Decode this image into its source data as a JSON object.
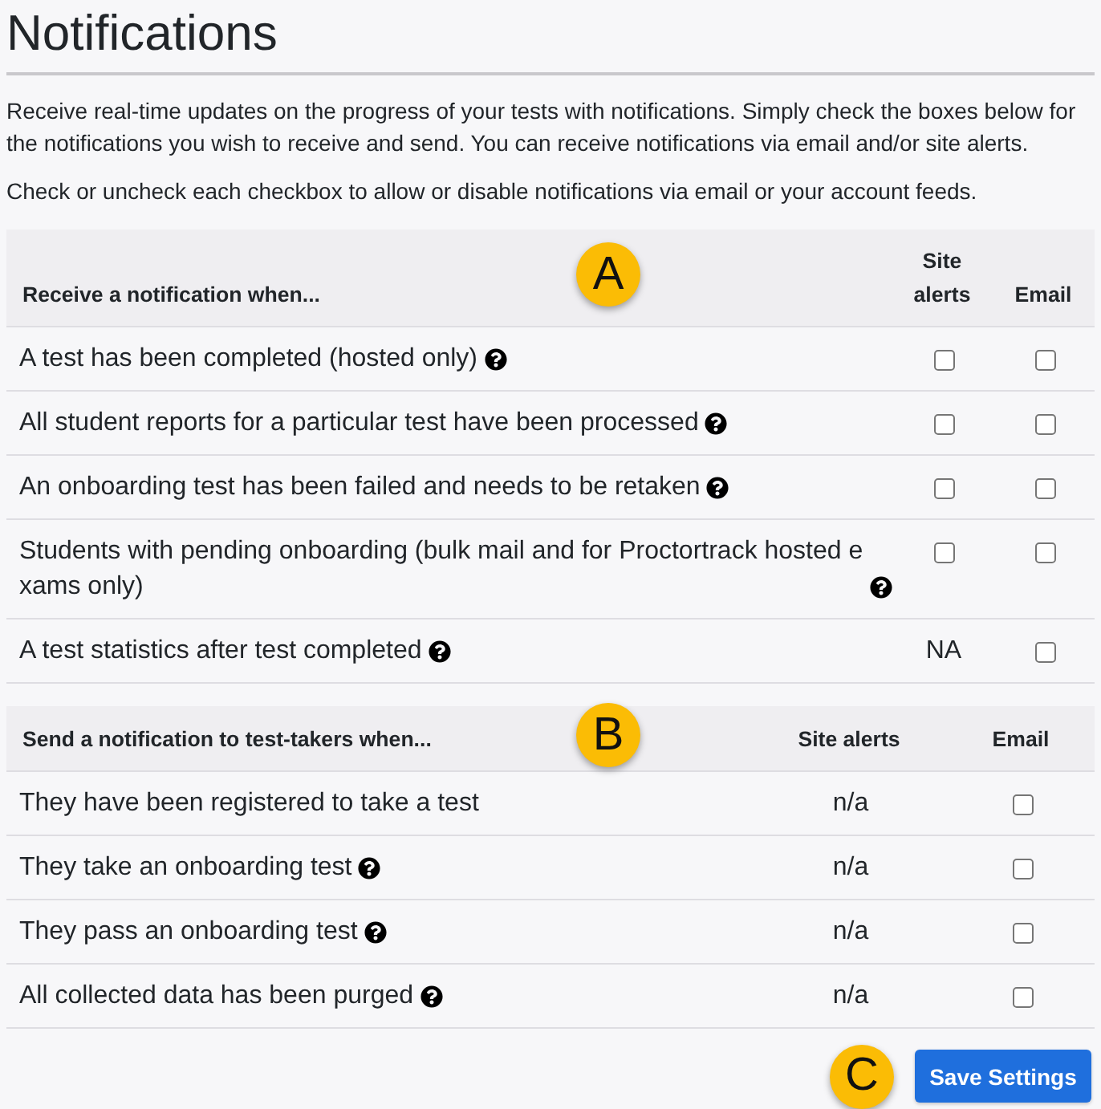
{
  "page": {
    "title": "Notifications",
    "intro": [
      "Receive real-time updates on the progress of your tests with notifications. Simply check the boxes below for the notifications you wish to receive and send. You can receive notifications via email and/or site alerts.",
      "Check or uncheck each checkbox to allow or disable notifications via email or your account feeds."
    ]
  },
  "receive_table": {
    "callout": "A",
    "columns": [
      "Receive a notification when...",
      "Site alerts",
      "Email"
    ],
    "rows": [
      {
        "label": "A test has been completed (hosted only)",
        "help": true,
        "site_alerts": {
          "kind": "checkbox",
          "checked": false
        },
        "email": {
          "kind": "checkbox",
          "checked": false
        }
      },
      {
        "label": "All student reports for a particular test have been processed",
        "help": true,
        "site_alerts": {
          "kind": "checkbox",
          "checked": false
        },
        "email": {
          "kind": "checkbox",
          "checked": false
        }
      },
      {
        "label": "An onboarding test has been failed and needs to be retaken",
        "help": true,
        "site_alerts": {
          "kind": "checkbox",
          "checked": false
        },
        "email": {
          "kind": "checkbox",
          "checked": false
        }
      },
      {
        "label": "Students with pending onboarding (bulk mail and for Proctortrack hosted exams only)",
        "help": true,
        "site_alerts": {
          "kind": "checkbox",
          "checked": false
        },
        "email": {
          "kind": "checkbox",
          "checked": false
        }
      },
      {
        "label": "A test statistics after test completed",
        "help": true,
        "site_alerts": {
          "kind": "text",
          "text": "NA"
        },
        "email": {
          "kind": "checkbox",
          "checked": false
        }
      }
    ]
  },
  "send_table": {
    "callout": "B",
    "columns": [
      "Send a notification to test-takers when...",
      "Site alerts",
      "Email"
    ],
    "rows": [
      {
        "label": "They have been registered to take a test",
        "help": false,
        "site_alerts": {
          "kind": "text",
          "text": "n/a"
        },
        "email": {
          "kind": "checkbox",
          "checked": false
        }
      },
      {
        "label": "They take an onboarding test",
        "help": true,
        "site_alerts": {
          "kind": "text",
          "text": "n/a"
        },
        "email": {
          "kind": "checkbox",
          "checked": false
        }
      },
      {
        "label": "They pass an onboarding test",
        "help": true,
        "site_alerts": {
          "kind": "text",
          "text": "n/a"
        },
        "email": {
          "kind": "checkbox",
          "checked": false
        }
      },
      {
        "label": "All collected data has been purged",
        "help": true,
        "site_alerts": {
          "kind": "text",
          "text": "n/a"
        },
        "email": {
          "kind": "checkbox",
          "checked": false
        }
      }
    ]
  },
  "footer": {
    "callout": "C",
    "save_button": "Save Settings"
  }
}
